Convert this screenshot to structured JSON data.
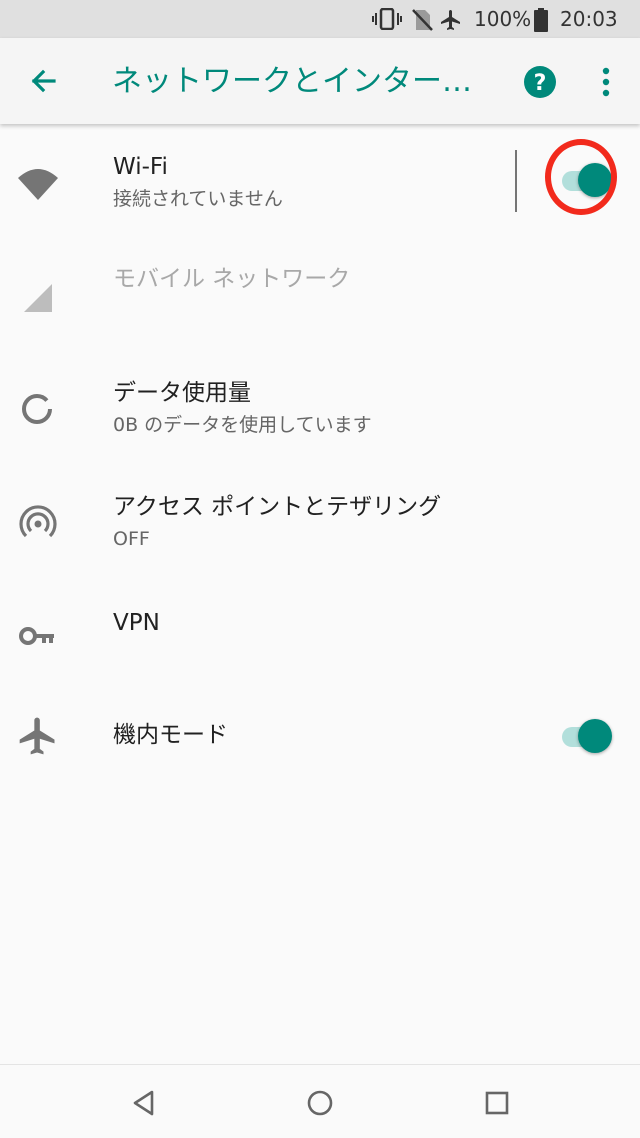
{
  "status_bar": {
    "battery_percent": "100%",
    "time": "20:03",
    "icons": [
      "vibrate-icon",
      "no-sim-icon",
      "airplane-icon",
      "battery-full-icon"
    ]
  },
  "app_bar": {
    "title": "ネットワークとインター…",
    "back_icon": "arrow-left-icon",
    "help_icon": "help-circle-icon",
    "more_icon": "more-vert-icon"
  },
  "settings": {
    "wifi": {
      "title": "Wi-Fi",
      "subtitle": "接続されていません",
      "enabled": true,
      "icon": "wifi-icon"
    },
    "mobile": {
      "title": "モバイル ネットワーク",
      "disabled": true,
      "icon": "cell-signal-icon"
    },
    "data_usage": {
      "title": "データ使用量",
      "subtitle": "0B のデータを使用しています",
      "icon": "data-usage-icon"
    },
    "hotspot": {
      "title": "アクセス ポイントとテザリング",
      "subtitle": "OFF",
      "icon": "hotspot-icon"
    },
    "vpn": {
      "title": "VPN",
      "icon": "key-icon"
    },
    "airplane": {
      "title": "機内モード",
      "enabled": true,
      "icon": "airplane-icon"
    }
  },
  "nav_bar": {
    "icons": [
      "back-triangle-icon",
      "home-circle-icon",
      "recents-square-icon"
    ]
  },
  "colors": {
    "accent": "#00897b",
    "toggle_track": "#b2dfdb",
    "highlight": "#f22a1c",
    "background": "#fafafa"
  }
}
